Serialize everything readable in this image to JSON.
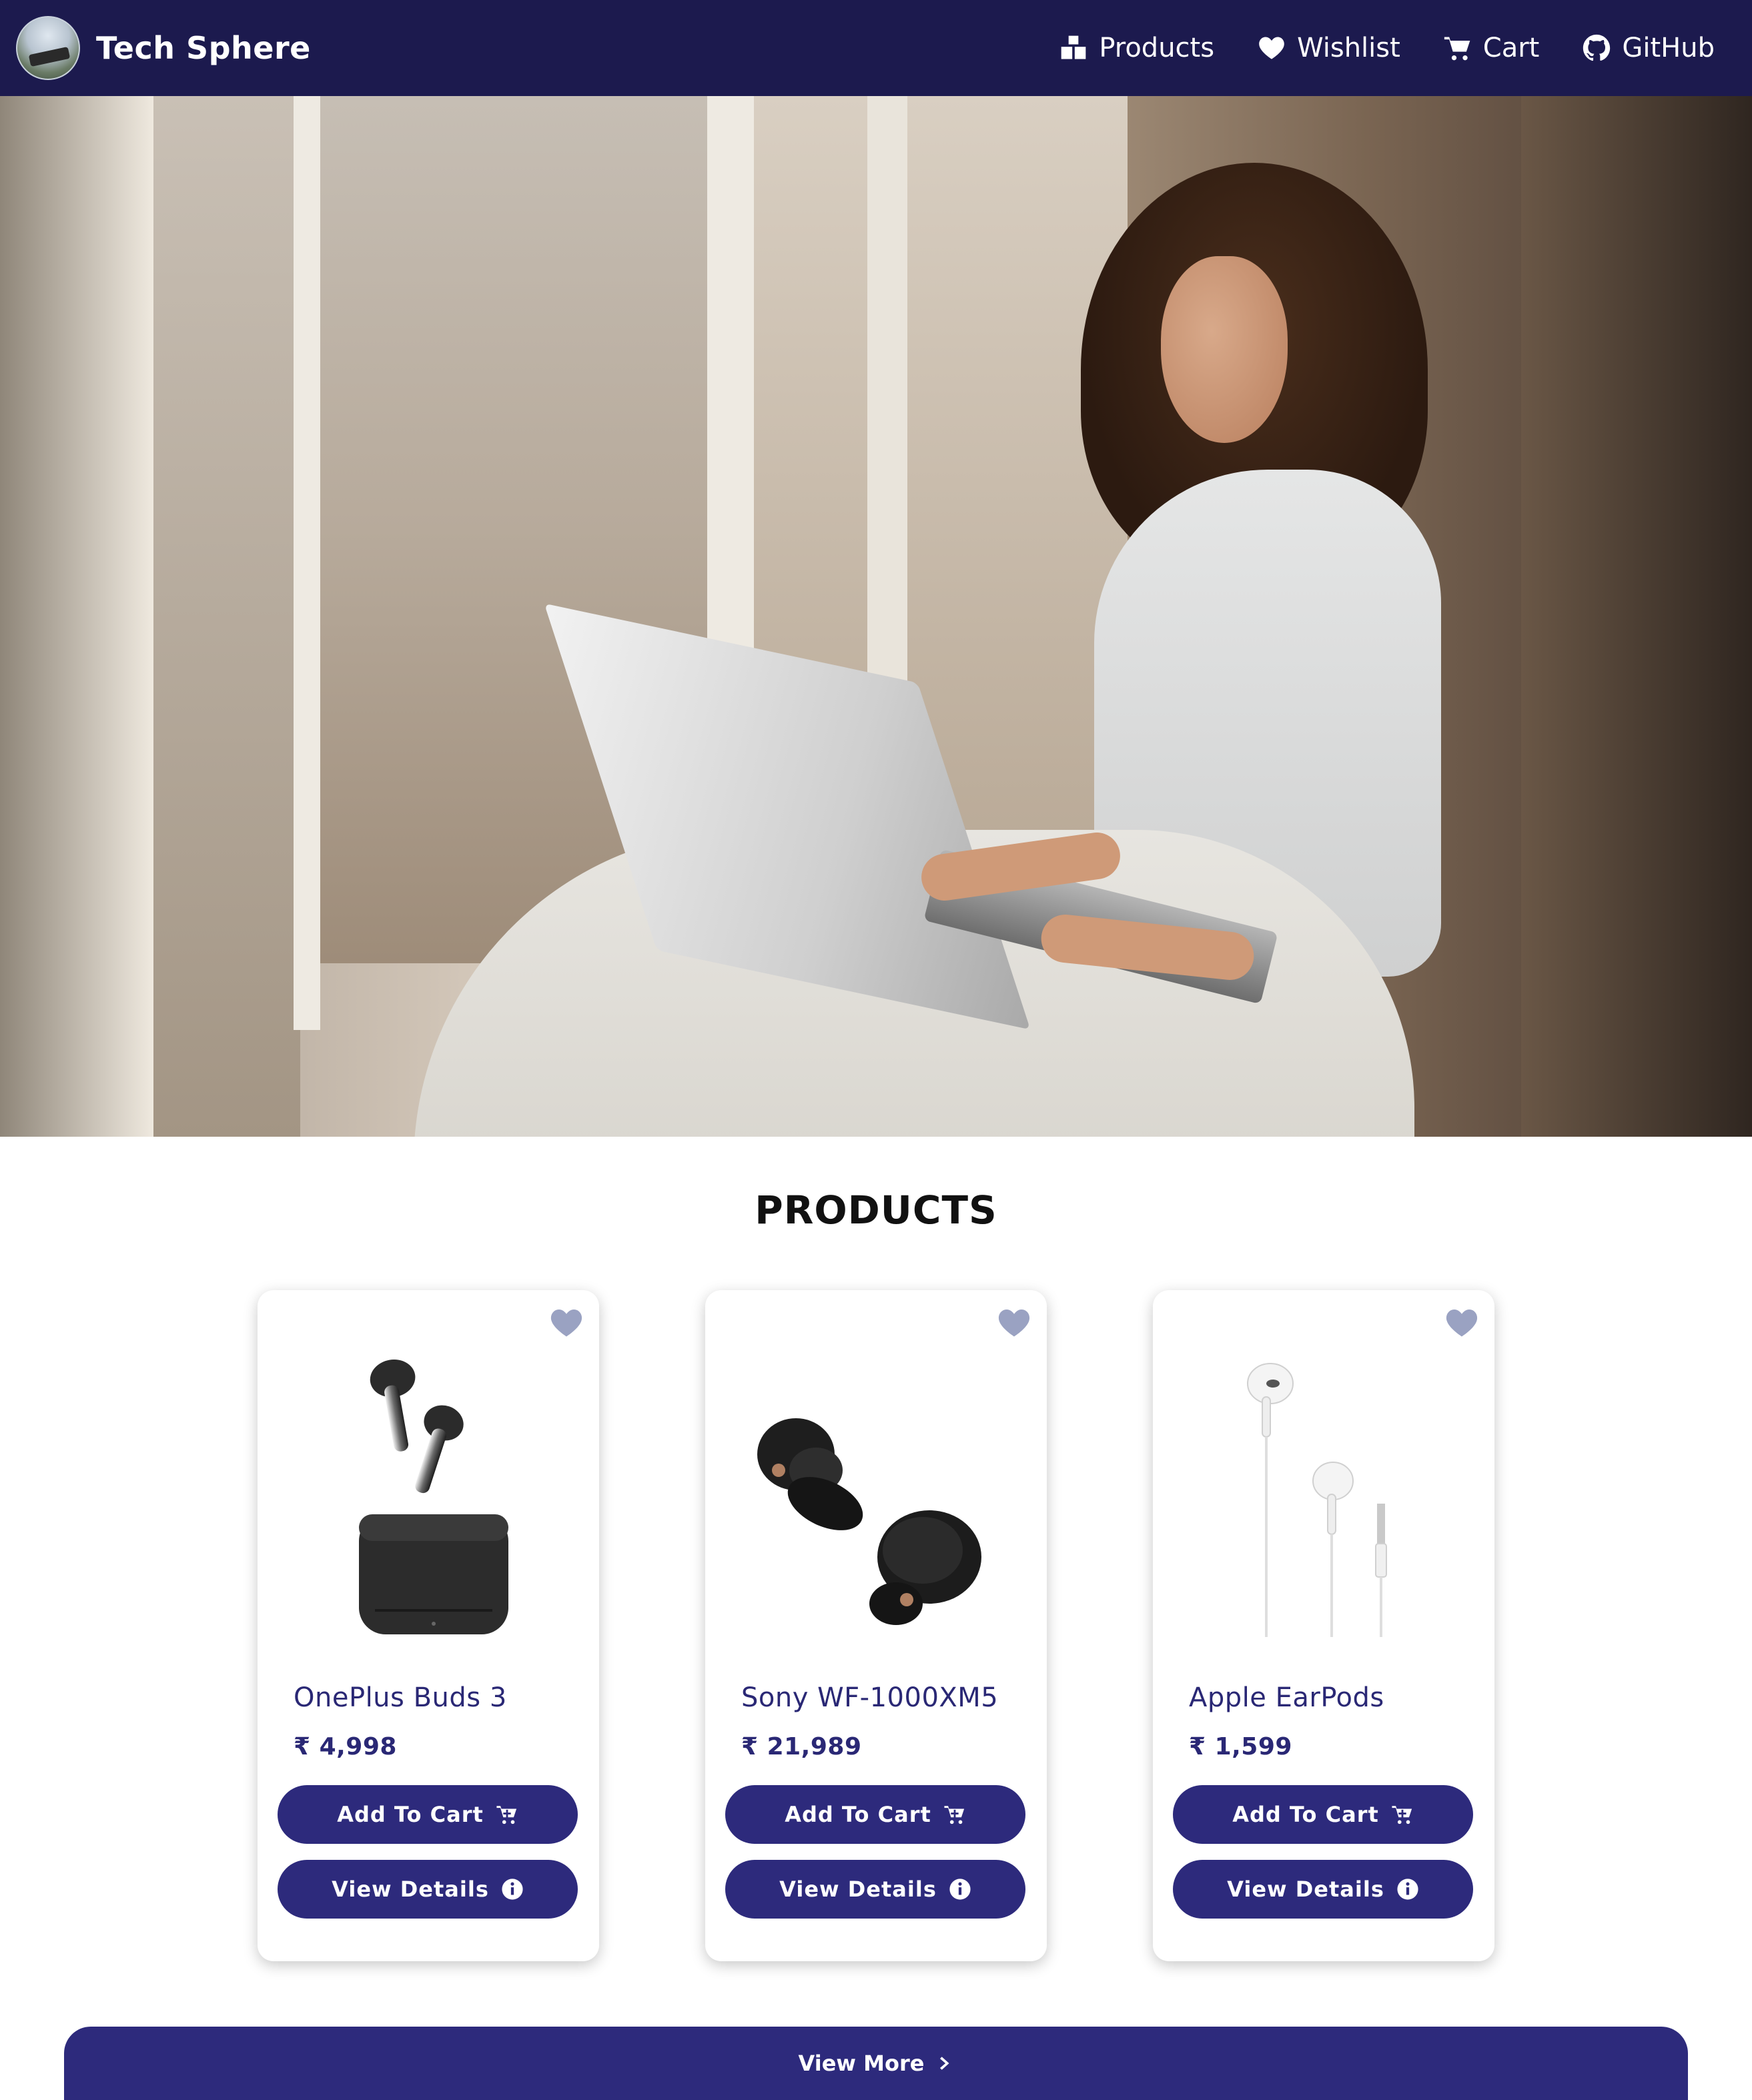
{
  "colors": {
    "navbar_bg": "#1c1a4e",
    "primary_button": "#2d2a7c",
    "product_text": "#2a2875",
    "heart": "#9aa2c2"
  },
  "navbar": {
    "brand": "Tech Sphere",
    "links": [
      {
        "label": "Products",
        "icon": "boxes-icon"
      },
      {
        "label": "Wishlist",
        "icon": "heart-icon"
      },
      {
        "label": "Cart",
        "icon": "cart-icon"
      },
      {
        "label": "GitHub",
        "icon": "github-icon"
      }
    ]
  },
  "hero": {
    "slide_count": 3,
    "active_slide": 3
  },
  "products": {
    "title": "PRODUCTS",
    "items": [
      {
        "name": "OnePlus Buds 3",
        "price": "₹ 4,998",
        "add_label": "Add To Cart",
        "details_label": "View Details",
        "image": "earbuds-with-case"
      },
      {
        "name": "Sony WF-1000XM5",
        "price": "₹ 21,989",
        "add_label": "Add To Cart",
        "details_label": "View Details",
        "image": "black-earbuds"
      },
      {
        "name": "Apple EarPods",
        "price": "₹ 1,599",
        "add_label": "Add To Cart",
        "details_label": "View Details",
        "image": "wired-earphones"
      }
    ],
    "view_more": "View More"
  }
}
